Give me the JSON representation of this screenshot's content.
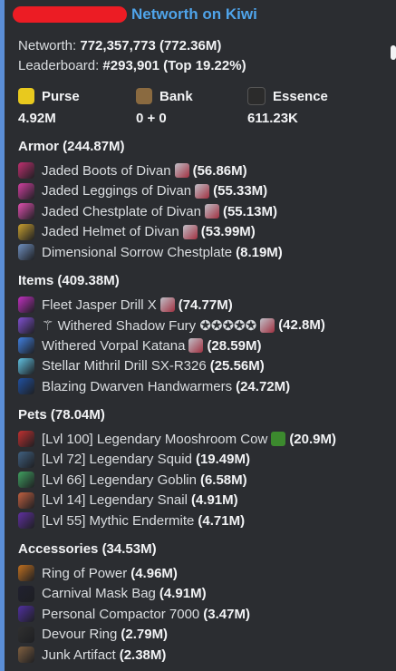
{
  "header": {
    "title": "Networth on Kiwi"
  },
  "summary": {
    "networth_label": "Networth:",
    "networth_value": "772,357,773",
    "networth_short": "(772.36M)",
    "leaderboard_label": "Leaderboard:",
    "leaderboard_value": "#293,901",
    "leaderboard_pct": "(Top 19.22%)"
  },
  "stats": [
    {
      "label": "Purse",
      "value": "4.92M",
      "icon": "gold-ingot-icon",
      "color": "#e8c91e"
    },
    {
      "label": "Bank",
      "value": "0 + 0",
      "icon": "chest-icon",
      "color": "#8a6a40"
    },
    {
      "label": "Essence",
      "value": "611.23K",
      "icon": "wither-essence-icon",
      "color": "#2b2b2b"
    }
  ],
  "sections": [
    {
      "title": "Armor (244.87M)",
      "items": [
        {
          "name": "Jaded Boots of Divan",
          "value": "(56.86M)",
          "icon_color": "#c03070",
          "has_gem": true
        },
        {
          "name": "Jaded Leggings of Divan",
          "value": "(55.33M)",
          "icon_color": "#d040a0",
          "has_gem": true
        },
        {
          "name": "Jaded Chestplate of Divan",
          "value": "(55.13M)",
          "icon_color": "#e050b0",
          "has_gem": true
        },
        {
          "name": "Jaded Helmet of Divan",
          "value": "(53.99M)",
          "icon_color": "#c8a030",
          "has_gem": true
        },
        {
          "name": "Dimensional Sorrow Chestplate",
          "value": "(8.19M)",
          "icon_color": "#7090c0",
          "has_gem": false
        }
      ]
    },
    {
      "title": "Items (409.38M)",
      "items": [
        {
          "name": "Fleet Jasper Drill X",
          "value": "(74.77M)",
          "icon_color": "#c030c0",
          "has_gem": true
        },
        {
          "name": "⚚ Withered Shadow Fury ✪✪✪✪✪",
          "value": "(42.8M)",
          "icon_color": "#8050d0",
          "has_gem": true
        },
        {
          "name": "Withered Vorpal Katana",
          "value": "(28.59M)",
          "icon_color": "#4080e0",
          "has_gem": true
        },
        {
          "name": "Stellar Mithril Drill SX-R326",
          "value": "(25.56M)",
          "icon_color": "#60c0e0",
          "has_gem": false
        },
        {
          "name": "Blazing Dwarven Handwarmers",
          "value": "(24.72M)",
          "icon_color": "#2050a0",
          "has_gem": false
        }
      ]
    },
    {
      "title": "Pets (78.04M)",
      "items": [
        {
          "name": "[Lvl 100] Legendary Mooshroom Cow",
          "value": "(20.9M)",
          "icon_color": "#c03030",
          "has_gem": false,
          "has_leaf": true
        },
        {
          "name": "[Lvl 72] Legendary Squid",
          "value": "(19.49M)",
          "icon_color": "#406080",
          "has_gem": false
        },
        {
          "name": "[Lvl 66] Legendary Goblin",
          "value": "(6.58M)",
          "icon_color": "#40a060",
          "has_gem": false
        },
        {
          "name": "[Lvl 14] Legendary Snail",
          "value": "(4.91M)",
          "icon_color": "#c06040",
          "has_gem": false
        },
        {
          "name": "[Lvl 55] Mythic Endermite",
          "value": "(4.71M)",
          "icon_color": "#6030a0",
          "has_gem": false
        }
      ]
    },
    {
      "title": "Accessories (34.53M)",
      "items": [
        {
          "name": "Ring of Power",
          "value": "(4.96M)",
          "icon_color": "#c07020",
          "has_gem": false
        },
        {
          "name": "Carnival Mask Bag",
          "value": "(4.91M)",
          "icon_color": "#202030",
          "has_gem": false
        },
        {
          "name": "Personal Compactor 7000",
          "value": "(3.47M)",
          "icon_color": "#5030a0",
          "has_gem": false
        },
        {
          "name": "Devour Ring",
          "value": "(2.79M)",
          "icon_color": "#303030",
          "has_gem": false
        },
        {
          "name": "Junk Artifact",
          "value": "(2.38M)",
          "icon_color": "#806040",
          "has_gem": false
        }
      ]
    }
  ]
}
